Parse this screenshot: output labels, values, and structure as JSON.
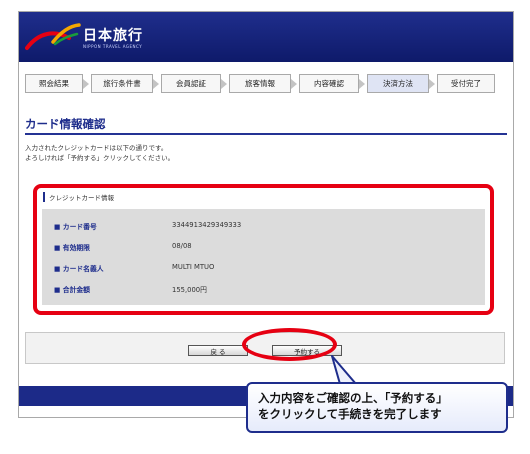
{
  "header": {
    "brand": "日本旅行",
    "sub": "NIPPON TRAVEL AGENCY"
  },
  "steps": [
    {
      "label": "照会結果"
    },
    {
      "label": "旅行条件書"
    },
    {
      "label": "会員認証"
    },
    {
      "label": "旅客情報"
    },
    {
      "label": "内容確認"
    },
    {
      "label": "決済方法",
      "active": true
    },
    {
      "label": "受付完了"
    }
  ],
  "page": {
    "title": "カード情報確認",
    "intro_line1": "入力されたクレジットカードは以下の通りです。",
    "intro_line2": "よろしければ「予約する」クリックしてください。"
  },
  "card_info": {
    "section_title": "クレジットカード情報",
    "rows": [
      {
        "label": "■ カード番号",
        "value": "3344913429349333"
      },
      {
        "label": "■ 有効期限",
        "value": "08/08"
      },
      {
        "label": "■ カード名義人",
        "value": "MULTI MTUO"
      },
      {
        "label": "■ 合計金額",
        "value": "155,000円"
      }
    ]
  },
  "actions": {
    "back_label": "戻 る",
    "reserve_label": "予約する"
  },
  "callout": {
    "line1": "入力内容をご確認の上、「予約する」",
    "line2": "をクリックして手続きを完了します"
  },
  "colors": {
    "brand_navy": "#1e2d8c",
    "highlight_red": "#e60012"
  }
}
